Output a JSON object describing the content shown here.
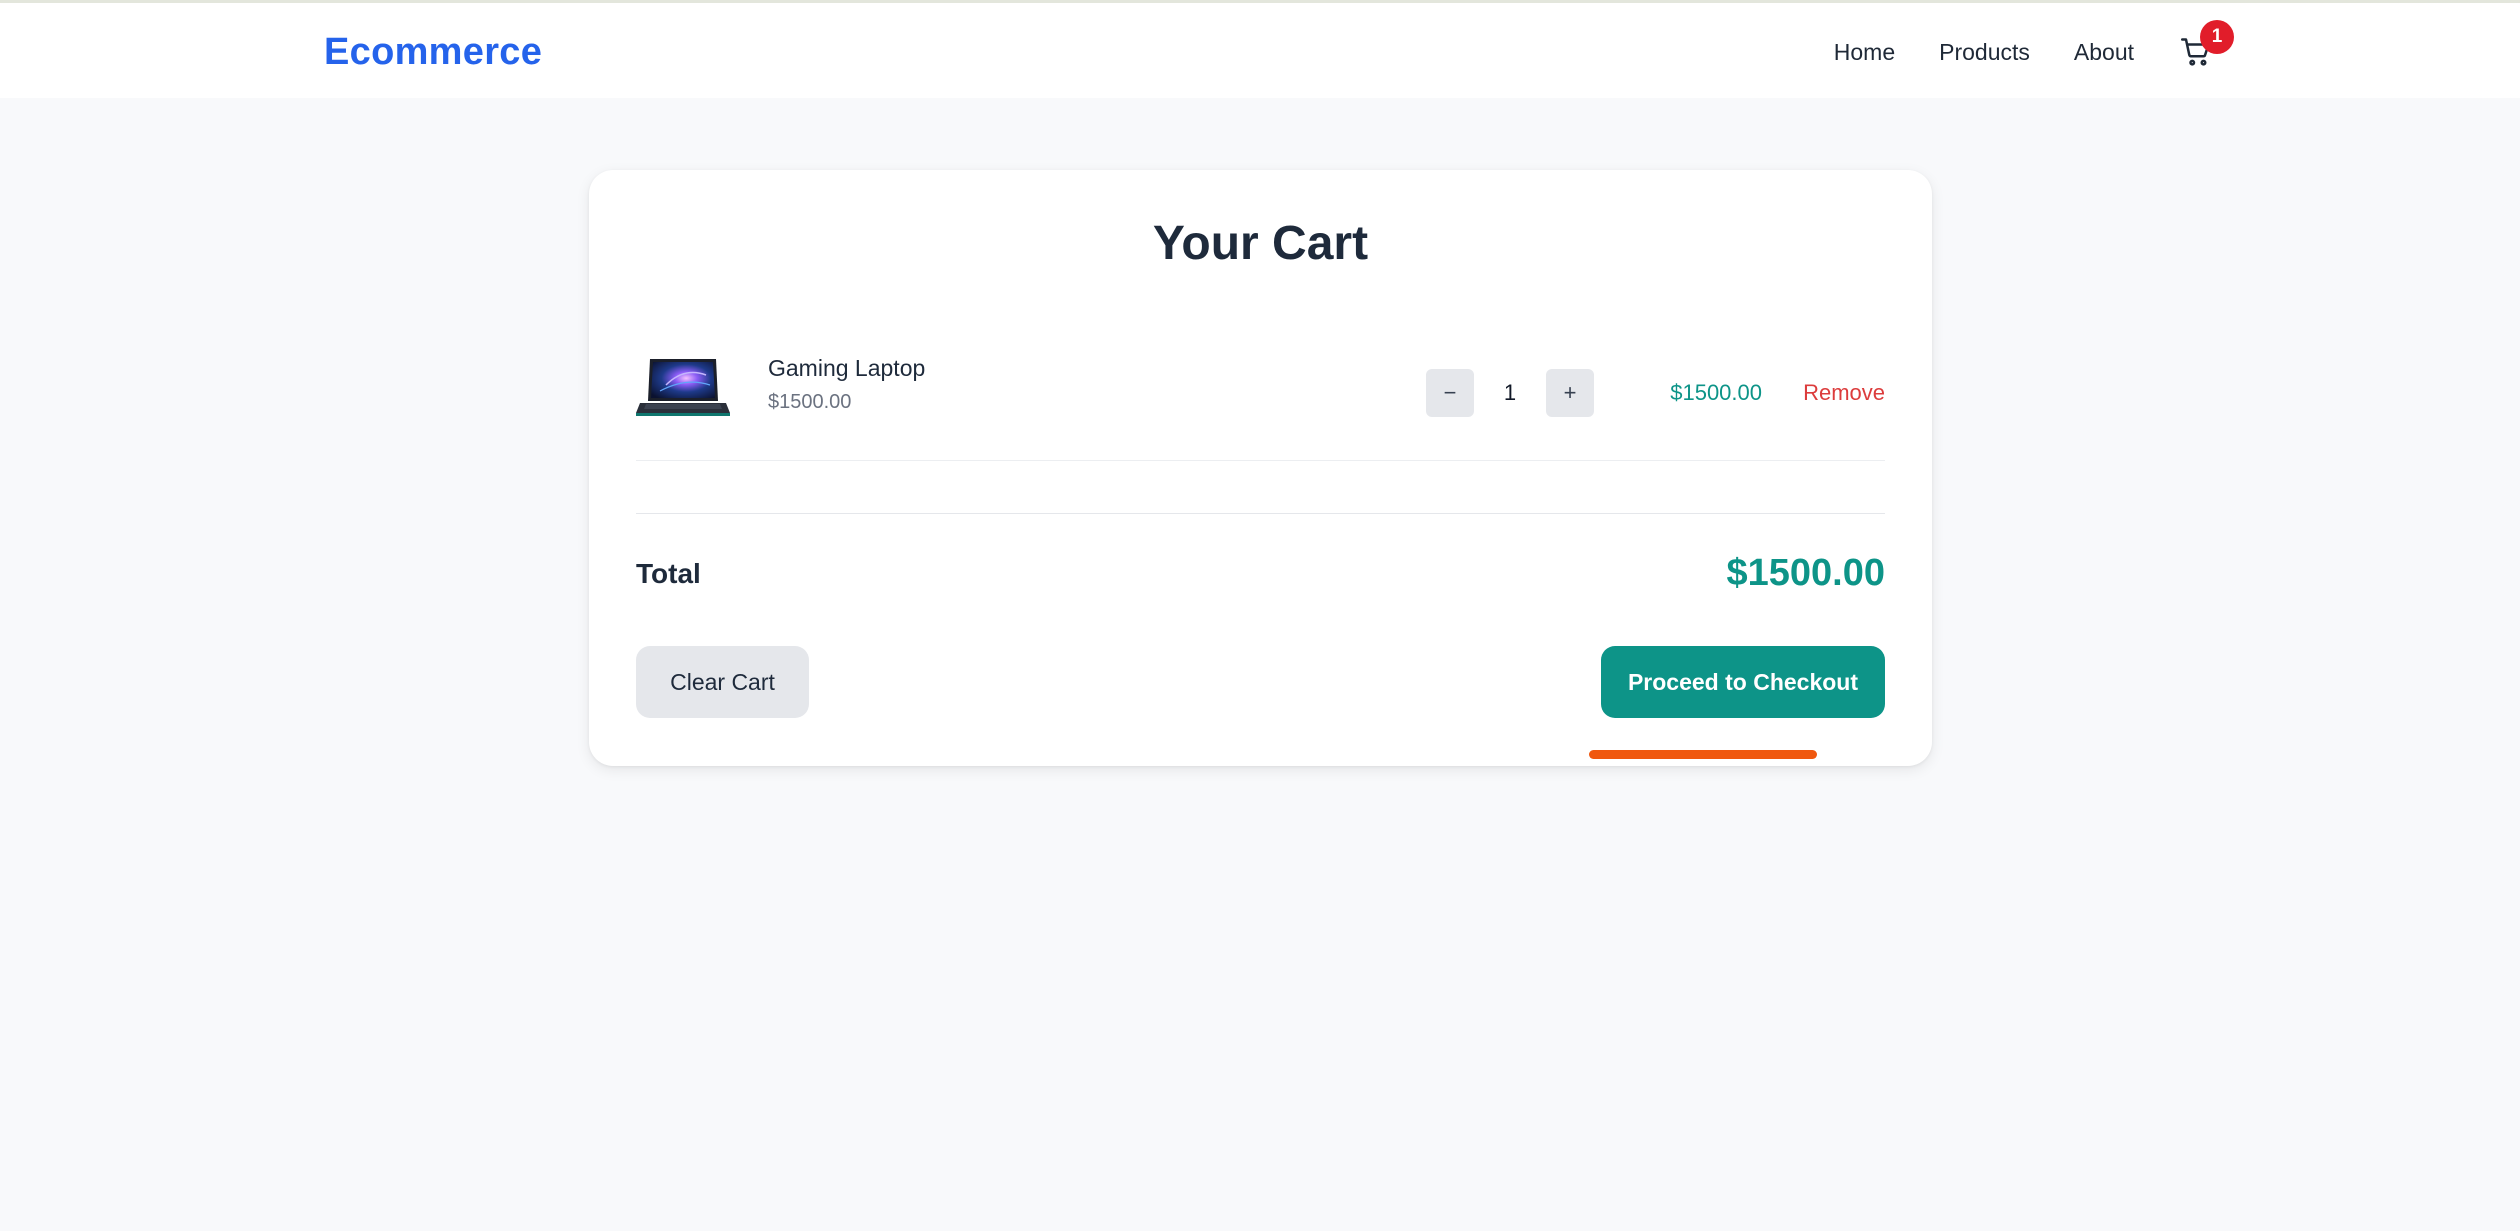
{
  "header": {
    "brand": "Ecommerce",
    "nav": [
      {
        "label": "Home"
      },
      {
        "label": "Products"
      },
      {
        "label": "About"
      }
    ],
    "cart_count": "1",
    "cart_icon": "shopping-cart-icon"
  },
  "cart": {
    "title": "Your Cart",
    "items": [
      {
        "name": "Gaming Laptop",
        "unit_price": "$1500.00",
        "quantity": "1",
        "line_total": "$1500.00",
        "remove_label": "Remove",
        "decrement_label": "−",
        "increment_label": "+",
        "thumbnail": "gaming-laptop-image"
      }
    ],
    "total_label": "Total",
    "total_value": "$1500.00",
    "clear_label": "Clear Cart",
    "checkout_label": "Proceed to Checkout"
  },
  "colors": {
    "brand": "#2563eb",
    "accent": "#0d9488",
    "danger": "#dc3c3c",
    "badge": "#e11d2a",
    "highlight": "#f0580f"
  }
}
